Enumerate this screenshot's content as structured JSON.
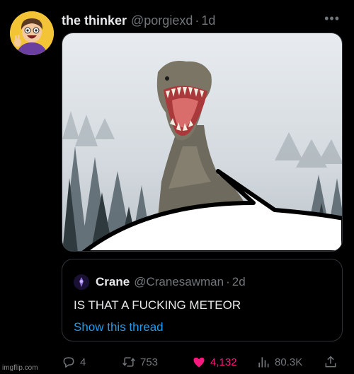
{
  "author": {
    "display_name": "the thinker",
    "handle": "@porgiexd",
    "separator": "·",
    "time": "1d"
  },
  "more_icon": "more-horizontal-icon",
  "quote": {
    "display_name": "Crane",
    "handle": "@Cranesawman",
    "separator": "·",
    "time": "2d",
    "text": "IS THAT A FUCKING METEOR",
    "show_thread": "Show this thread"
  },
  "actions": {
    "replies": "4",
    "retweets": "753",
    "likes": "4,132",
    "views": "80.3K"
  },
  "colors": {
    "background": "#000000",
    "text": "#e7e9ea",
    "muted": "#71767b",
    "link": "#1d9bf0",
    "like": "#f91880",
    "border": "#2f3336"
  },
  "watermark": "imgflip.com"
}
